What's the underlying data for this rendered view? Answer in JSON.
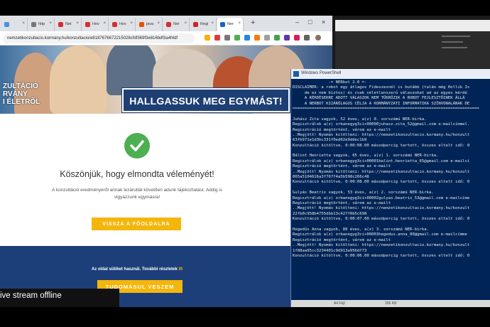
{
  "browser": {
    "tabs": [
      {
        "label": "",
        "color": "#4a90e2",
        "active": false
      },
      {
        "label": "http",
        "color": "#777777",
        "active": false
      },
      {
        "label": "Net",
        "color": "#d32f2f",
        "active": false
      },
      {
        "label": "Hov",
        "color": "#d32f2f",
        "active": false
      },
      {
        "label": "Hov",
        "color": "#d32f2f",
        "active": false
      },
      {
        "label": "java",
        "color": "#e65100",
        "active": false
      },
      {
        "label": "Ner",
        "color": "#d32f2f",
        "active": false
      },
      {
        "label": "Regi",
        "color": "#c62828",
        "active": false
      },
      {
        "label": "Ner",
        "color": "#1565c0",
        "active": true
      }
    ],
    "new_tab": "+",
    "window_controls": {
      "minimize": "–",
      "maximize": "□",
      "close": "×"
    },
    "url": "nemzetikonzultacio.kormany.hu/konzultacio/e8187676672215028cfdf369f3e816bdf3a4f4df"
  },
  "page": {
    "hero_left_lines": [
      "ZULTÁCIÓ",
      "RVÁNY",
      "I ÉLETRŐL"
    ],
    "hero_banner": "HALLGASSUK MEG EGYMÁST!",
    "thanks": "Köszönjük, hogy elmondta véleményét!",
    "info": "A konzultáció eredményéről annak lezárultát követően adunk tájékoztatást. Addig is vigyázzunk egymásra!",
    "back_button": "VISSZA A FŐOLDALRA",
    "cookie_text": "Az oldal sütiket használ. További részletek ",
    "cookie_link": "itt",
    "accept_button": "TUDOMÁSUL VESZEM"
  },
  "powershell": {
    "title": "Windows PowerShell",
    "lines": [
      "               -= NERbot 2.0 =-",
      "DISCLAIMER: a robot egy átlagos Fideszesnél is butább (talán még Hollik Is",
      "     de ez nem biztos) és csak véletlenszerű válaszokat ad az egyes kérdé",
      "     A KÉRDÉSEKRE ADOTT VÁLASZOK NEM TÜKRÖZIK A ROBOT FEJLESZTŐINEK ÁLLÁ",
      "     A NERBOT KIZÁRÓLAGOS CÉLJA A KORMÁNYZATI INFORMATIKA SZÍNVONALÁNAK DE",
      "==============================================================================",
      "",
      "Juhász Zita vagyok, 52 éves, a(z) 0. sorszámú NER-birka.",
      "Regisztrálok a(z) orbanegyg3ci+00000juhasz.zita_52@gmail.com e-mailcímmel.",
      "Regisztráció megtörtént, várom az e-mailt",
      "..Megjött! Nyomás kitölteni: https://nemzetikonzultacio.kormany.hu/konzult",
      "63fb971e1d3bc331f0ed02e9ddec1b9",
      "Konzultáció kitöltve, 0:00:08.00 másodpercig tartott, összes eltelt idő: 0",
      "",
      "Bálint Henrietta vagyok, 65 éves, a(z) 1. sorszámú NER-birka.",
      "Regisztrálok a(z) orbanegyg3ci+00001balint.henrietta_65@gmail.com e-mailcí",
      "Regisztráció megtörtént, várom az e-mailt",
      "..Megjött! Nyomás kitölteni: https://nemzetikonzultacio.kormany.hu/konzult",
      "065a5104616a3f767f4a5b598c266c48",
      "Konzultáció kitöltve, 0:00:08.00 másodpercig tartott, összes eltelt idő: 0",
      "",
      "Gulyás Beatrix vagyok, 53 éves, a(z) 2. sorszámú NER-birka.",
      "Regisztrálok a(z) orbanegyg3ci+00002gulyas.beatrix_53@gmail.com e-mailcíme",
      "Regisztráció megtörtént, várom az e-mailt",
      "..Megjött! Nyomás kitölteni: https://nemzetikonzultacio.kormany.hu/konzult",
      "22fb0c958b4755dbb13c427f0b5c698",
      "Konzultáció kitöltve, 0:00:07.00 másodpercig tartott, összes eltelt idő: 0",
      "",
      "Hegedűs Anna vagyok, 80 éves, a(z) 3. sorszámú NER-birka.",
      "Regisztrálok a(z) orbanegyg3ci+00003hegedus.anna_80@gmail.com e-mailcímme",
      "Regisztráció megtörtént, várom az e-mailt",
      "..Megjött! Nyomás kitölteni: https://nemzetikonzultacio.kormany.hu/konzult",
      "1f88aa95cc3234401c9d913a956df73",
      "Konzultáció kitöltve, 0:00:06.00 másodpercig tartott, összes eltelt idő: 0"
    ],
    "status_left": "A4 Fájl",
    "status_mid": "306 KB"
  },
  "stream": {
    "label": "ive stream offline"
  }
}
